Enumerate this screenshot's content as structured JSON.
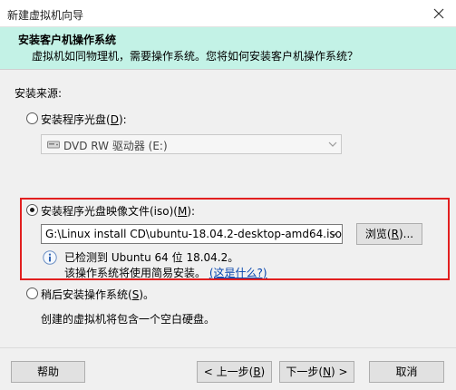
{
  "window": {
    "title": "新建虚拟机向导"
  },
  "header": {
    "title": "安装客户机操作系统",
    "subtitle": "虚拟机如同物理机，需要操作系统。您将如何安装客户机操作系统？"
  },
  "source": {
    "label": "安装来源:",
    "option_disc": {
      "label_pre": "安装程序光盘(",
      "mnemonic": "D",
      "label_post": "):",
      "selected": false
    },
    "dvd_select_value": "DVD RW 驱动器 (E:)",
    "option_iso": {
      "label_pre": "安装程序光盘映像文件(iso)(",
      "mnemonic": "M",
      "label_post": "):",
      "selected": true
    },
    "iso_path": "G:\\Linux install CD\\ubuntu-18.04.2-desktop-amd64.iso",
    "browse": {
      "label_pre": "浏览(",
      "mnemonic": "R",
      "label_post": ")..."
    },
    "detected_text": "已检测到 Ubuntu 64 位 18.04.2。",
    "easy_install_text": "该操作系统将使用简易安装。",
    "whats_this_link": "(这是什么?)",
    "option_later": {
      "label_pre": "稍后安装操作系统(",
      "mnemonic": "S",
      "label_post": ")。",
      "selected": false
    },
    "later_description": "创建的虚拟机将包含一个空白硬盘。"
  },
  "footer": {
    "help": "帮助",
    "back": {
      "label_pre": "< 上一步(",
      "mnemonic": "B",
      "label_post": ")"
    },
    "next": {
      "label_pre": "下一步(",
      "mnemonic": "N",
      "label_post": ") >"
    },
    "cancel": "取消"
  },
  "colors": {
    "header_bg": "#c3f2e6",
    "highlight_border": "#e21f1f",
    "link": "#0645ad"
  }
}
